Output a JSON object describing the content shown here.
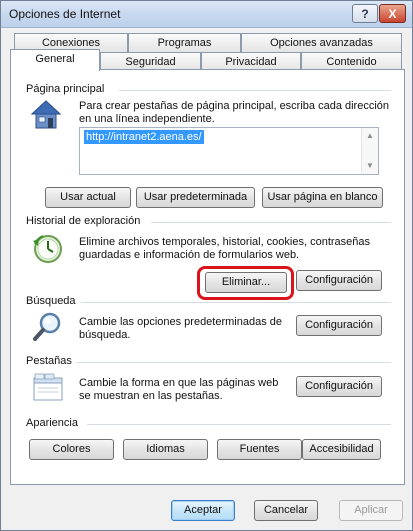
{
  "window": {
    "title": "Opciones de Internet",
    "help_glyph": "?",
    "close_glyph": "X"
  },
  "tabs": {
    "row1": [
      "Conexiones",
      "Programas",
      "Opciones avanzadas"
    ],
    "row2": [
      "General",
      "Seguridad",
      "Privacidad",
      "Contenido"
    ],
    "active": "General"
  },
  "home": {
    "label": "Página principal",
    "description_line1": "Para crear pestañas de página principal, escriba cada dirección",
    "description_line2": "en una línea independiente.",
    "url": "http://intranet2.aena.es/",
    "btn_current": "Usar actual",
    "btn_default": "Usar predeterminada",
    "btn_blank": "Usar página en blanco"
  },
  "history": {
    "label": "Historial de exploración",
    "description_line1": "Elimine archivos temporales, historial, cookies, contraseñas",
    "description_line2": "guardadas e información de formularios web.",
    "btn_delete": "Eliminar...",
    "btn_settings": "Configuración"
  },
  "search": {
    "label": "Búsqueda",
    "description_line1": "Cambie las opciones predeterminadas de",
    "description_line2": "búsqueda.",
    "btn_settings": "Configuración"
  },
  "tabs_section": {
    "label": "Pestañas",
    "description_line1": "Cambie la forma en que las páginas web",
    "description_line2": "se muestran en las pestañas.",
    "btn_settings": "Configuración"
  },
  "appearance": {
    "label": "Apariencia",
    "btn_colors": "Colores",
    "btn_languages": "Idiomas",
    "btn_fonts": "Fuentes",
    "btn_accessibility": "Accesibilidad"
  },
  "footer": {
    "btn_ok": "Aceptar",
    "btn_cancel": "Cancelar",
    "btn_apply": "Aplicar"
  },
  "colors": {
    "highlight_ring": "#d9141d",
    "url_selection": "#3399ff"
  }
}
